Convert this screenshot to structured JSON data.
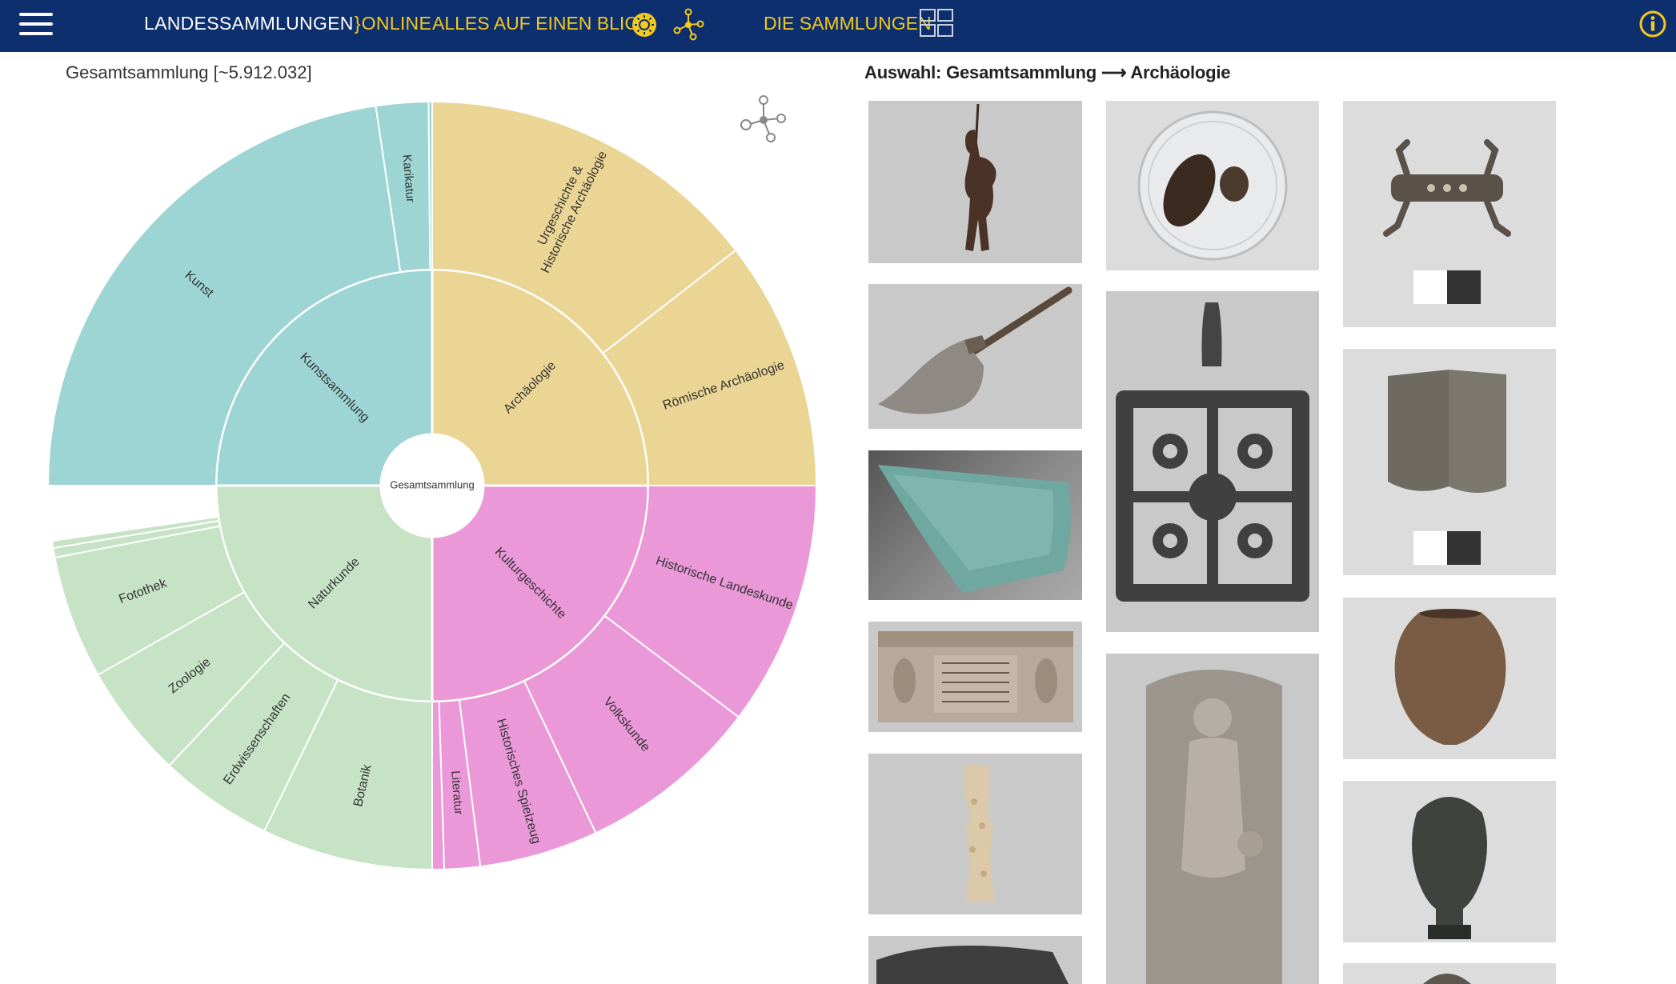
{
  "header": {
    "brand_main": "LANDESSAMMLUNGEN",
    "brand_sep": "}",
    "brand_hl": "ONLINE",
    "nav_overview": "ALLES AUF EINEN BLICK",
    "nav_collections": "DIE SAMMLUNGEN",
    "icons": [
      "menu-icon",
      "sun-icon",
      "network-icon",
      "grid-icon",
      "info-icon"
    ]
  },
  "left": {
    "collection_title": "Gesamtsammlung [~5.912.032]"
  },
  "right": {
    "breadcrumb": "Auswahl: Gesamtsammlung ⟶ Archäologie",
    "thumbnails": [
      "bronze-figure-with-spear",
      "axe-with-handle",
      "turquoise-glass-fragment",
      "inscribed-stone-urn",
      "bone-object",
      "dark-stone-fragment",
      "petri-dish-seeds",
      "openwork-metal-fitting",
      "relief-stone-figure",
      "bronze-fibula",
      "lead-plate",
      "ceramic-vessel",
      "bronze-head",
      "bowl-fragment"
    ]
  },
  "chart_data": {
    "type": "sunburst",
    "center": "Gesamtsammlung",
    "colors": {
      "Kunstsammlung": "#9dd5d4",
      "Archäologie": "#ebd594",
      "Kulturgeschichte": "#ea98d8",
      "Naturkunde": "#c6e3c5"
    },
    "inner": [
      {
        "name": "Kunstsammlung",
        "share": 0.25
      },
      {
        "name": "Archäologie",
        "share": 0.25
      },
      {
        "name": "Kulturgeschichte",
        "share": 0.25
      },
      {
        "name": "Naturkunde",
        "share": 0.25
      }
    ],
    "outer": [
      {
        "name": "Ur­geschichte & Historische Archäologie",
        "parent": "Archäologie",
        "share": 0.145
      },
      {
        "name": "Römische Archäologie",
        "parent": "Archäologie",
        "share": 0.105
      },
      {
        "name": "Historische Landeskunde",
        "parent": "Kulturgeschichte",
        "share": 0.103
      },
      {
        "name": "Volkskunde",
        "parent": "Kulturgeschichte",
        "share": 0.077
      },
      {
        "name": "Historisches Spielzeug",
        "parent": "Kulturgeschichte",
        "share": 0.05
      },
      {
        "name": "Literatur",
        "parent": "Kulturgeschichte",
        "share": 0.015
      },
      {
        "name": "",
        "parent": "Kulturgeschichte",
        "share": 0.005
      },
      {
        "name": "Botanik",
        "parent": "Naturkunde",
        "share": 0.072
      },
      {
        "name": "Erdwissenschaften",
        "parent": "Naturkunde",
        "share": 0.048
      },
      {
        "name": "Zoologie",
        "parent": "Naturkunde",
        "share": 0.048
      },
      {
        "name": "Fotothek",
        "parent": "Naturkunde",
        "share": 0.052
      },
      {
        "name": "",
        "parent": "Naturkunde",
        "share": 0.004
      },
      {
        "name": "",
        "parent": "Naturkunde",
        "share": 0.003
      },
      {
        "name": "Kunst",
        "parent": "Kunstsammlung",
        "share": 0.2265
      },
      {
        "name": "Karikatur",
        "parent": "Kunstsammlung",
        "share": 0.022
      },
      {
        "name": "",
        "parent": "Kunstsammlung",
        "share": 0.0015
      }
    ]
  }
}
